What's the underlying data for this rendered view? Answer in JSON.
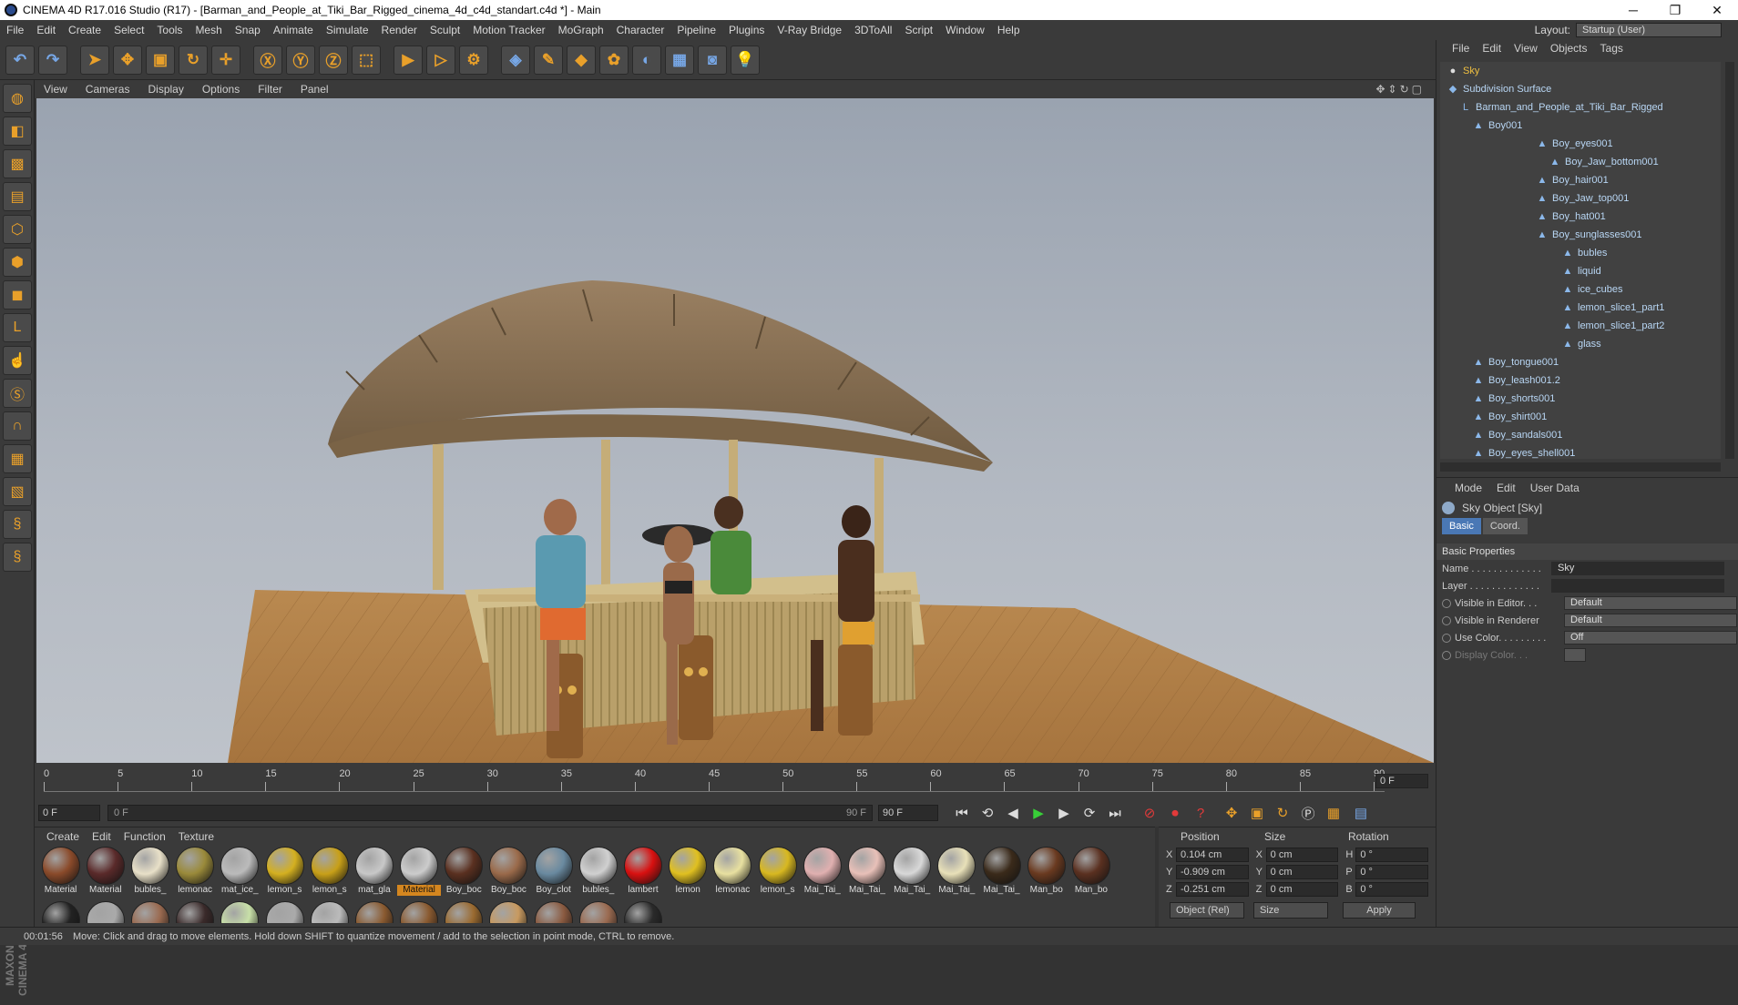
{
  "window": {
    "title": "CINEMA 4D R17.016 Studio (R17) - [Barman_and_People_at_Tiki_Bar_Rigged_cinema_4d_c4d_standart.c4d *] - Main",
    "minimize": "─",
    "restore": "❐",
    "close": "✕"
  },
  "menubar": {
    "items": [
      "File",
      "Edit",
      "Create",
      "Select",
      "Tools",
      "Mesh",
      "Snap",
      "Animate",
      "Simulate",
      "Render",
      "Sculpt",
      "Motion Tracker",
      "MoGraph",
      "Character",
      "Pipeline",
      "Plugins",
      "V-Ray Bridge",
      "3DToAll",
      "Script",
      "Window",
      "Help"
    ],
    "layout_label": "Layout:",
    "layout_value": "Startup (User)"
  },
  "viewport": {
    "menu": [
      "View",
      "Cameras",
      "Display",
      "Options",
      "Filter",
      "Panel"
    ],
    "corner_icons": "✥⇕↻▢"
  },
  "timeline": {
    "ticks": [
      "0",
      "5",
      "10",
      "15",
      "20",
      "25",
      "30",
      "35",
      "40",
      "45",
      "50",
      "55",
      "60",
      "65",
      "70",
      "75",
      "80",
      "85",
      "90"
    ],
    "current_frame": "0 F",
    "start_field": "0 F",
    "slider_start": "0 F",
    "slider_end": "90 F",
    "end_field": "90 F"
  },
  "materials": {
    "menu": [
      "Create",
      "Edit",
      "Function",
      "Texture"
    ],
    "row1": [
      {
        "label": "Material",
        "color": "#8a4a2a"
      },
      {
        "label": "Material",
        "color": "#5a2a2a"
      },
      {
        "label": "bubles_",
        "color": "#e8e0c8"
      },
      {
        "label": "lemonac",
        "color": "#9a8a3a"
      },
      {
        "label": "mat_ice_",
        "color": "#bbbbbb"
      },
      {
        "label": "lemon_s",
        "color": "#d4b020"
      },
      {
        "label": "lemon_s",
        "color": "#c8a018"
      },
      {
        "label": "mat_gla",
        "color": "#c8c8c8"
      },
      {
        "label": "Material",
        "color": "#cccccc",
        "selected": true
      },
      {
        "label": "Boy_boc",
        "color": "#5a3020"
      },
      {
        "label": "Boy_boc",
        "color": "#9a6a4a"
      },
      {
        "label": "Boy_clot",
        "color": "#6a8aa0"
      },
      {
        "label": "bubles_",
        "color": "#d0d0d0"
      },
      {
        "label": "lambert",
        "color": "#d81010"
      },
      {
        "label": "lemon",
        "color": "#e0c020"
      },
      {
        "label": "lemonac",
        "color": "#e8e0a0"
      },
      {
        "label": "lemon_s",
        "color": "#d8b820"
      },
      {
        "label": "Mai_Tai_",
        "color": "#e0b0b0"
      },
      {
        "label": "Mai_Tai_",
        "color": "#e8c0b8"
      },
      {
        "label": "Mai_Tai_",
        "color": "#d8d8d8"
      },
      {
        "label": "Mai_Tai_",
        "color": "#e8e0b8"
      },
      {
        "label": "Mai_Tai_",
        "color": "#3a2a1a"
      },
      {
        "label": "Man_bo",
        "color": "#6a3a20"
      },
      {
        "label": "Man_bo",
        "color": "#5a3020"
      }
    ],
    "row2": [
      "#222222",
      "#aaaaaa",
      "#9a6a50",
      "#3a2a2a",
      "#c8e0a8",
      "#aaaaaa",
      "#bbbbbb",
      "#8a5a30",
      "#8a5a30",
      "#9a6a30",
      "#c89a60",
      "#8a5a40",
      "#9a6a50",
      "#2a2a2a"
    ]
  },
  "coords": {
    "headers": [
      "Position",
      "Size",
      "Rotation"
    ],
    "rows": [
      {
        "ax1": "X",
        "pos": "0.104 cm",
        "ax2": "X",
        "size": "0 cm",
        "ax3": "H",
        "rot": "0 °"
      },
      {
        "ax1": "Y",
        "pos": "-0.909 cm",
        "ax2": "Y",
        "size": "0 cm",
        "ax3": "P",
        "rot": "0 °"
      },
      {
        "ax1": "Z",
        "pos": "-0.251 cm",
        "ax2": "Z",
        "size": "0 cm",
        "ax3": "B",
        "rot": "0 °"
      }
    ],
    "mode_dropdown": "Object (Rel)",
    "size_dropdown": "Size",
    "apply": "Apply"
  },
  "objects": {
    "menu": [
      "File",
      "Edit",
      "View",
      "Objects",
      "Tags"
    ],
    "items": [
      {
        "label": "Sky",
        "indent": 0,
        "highlight": true,
        "icon": "●"
      },
      {
        "label": "Subdivision Surface",
        "indent": 0,
        "icon": "◆"
      },
      {
        "label": "Barman_and_People_at_Tiki_Bar_Rigged",
        "indent": 1,
        "icon": "L"
      },
      {
        "label": "Boy001",
        "indent": 2,
        "icon": "▲"
      },
      {
        "label": "Boy_eyes001",
        "indent": 7,
        "icon": "▲"
      },
      {
        "label": "Boy_Jaw_bottom001",
        "indent": 8,
        "icon": "▲"
      },
      {
        "label": "Boy_hair001",
        "indent": 7,
        "icon": "▲"
      },
      {
        "label": "Boy_Jaw_top001",
        "indent": 7,
        "icon": "▲"
      },
      {
        "label": "Boy_hat001",
        "indent": 7,
        "icon": "▲"
      },
      {
        "label": "Boy_sunglasses001",
        "indent": 7,
        "icon": "▲"
      },
      {
        "label": "bubles",
        "indent": 9,
        "icon": "▲"
      },
      {
        "label": "liquid",
        "indent": 9,
        "icon": "▲"
      },
      {
        "label": "ice_cubes",
        "indent": 9,
        "icon": "▲"
      },
      {
        "label": "lemon_slice1_part1",
        "indent": 9,
        "icon": "▲"
      },
      {
        "label": "lemon_slice1_part2",
        "indent": 9,
        "icon": "▲"
      },
      {
        "label": "glass",
        "indent": 9,
        "icon": "▲"
      },
      {
        "label": "Boy_tongue001",
        "indent": 2,
        "icon": "▲"
      },
      {
        "label": "Boy_leash001.2",
        "indent": 2,
        "icon": "▲"
      },
      {
        "label": "Boy_shorts001",
        "indent": 2,
        "icon": "▲"
      },
      {
        "label": "Boy_shirt001",
        "indent": 2,
        "icon": "▲"
      },
      {
        "label": "Boy_sandals001",
        "indent": 2,
        "icon": "▲"
      },
      {
        "label": "Boy_eyes_shell001",
        "indent": 2,
        "icon": "▲"
      }
    ]
  },
  "attributes": {
    "menu": [
      "Mode",
      "Edit",
      "User Data"
    ],
    "object_title": "Sky Object [Sky]",
    "tabs": [
      "Basic",
      "Coord."
    ],
    "section": "Basic Properties",
    "props": [
      {
        "label": "Name . . . . . . . . . . . . .",
        "value": "Sky",
        "type": "text"
      },
      {
        "label": "Layer . . . . . . . . . . . . .",
        "value": "",
        "type": "text"
      },
      {
        "label": "Visible in Editor. . .",
        "value": "Default",
        "type": "dd"
      },
      {
        "label": "Visible in Renderer",
        "value": "Default",
        "type": "dd"
      },
      {
        "label": "Use Color. . . . . . . . .",
        "value": "Off",
        "type": "dd"
      },
      {
        "label": "Display Color. . .",
        "value": "",
        "type": "dim"
      }
    ]
  },
  "status": {
    "time": "00:01:56",
    "message": "Move: Click and drag to move elements. Hold down SHIFT to quantize movement / add to the selection in point mode, CTRL to remove."
  },
  "brand": "MAXON CINEMA 4D"
}
